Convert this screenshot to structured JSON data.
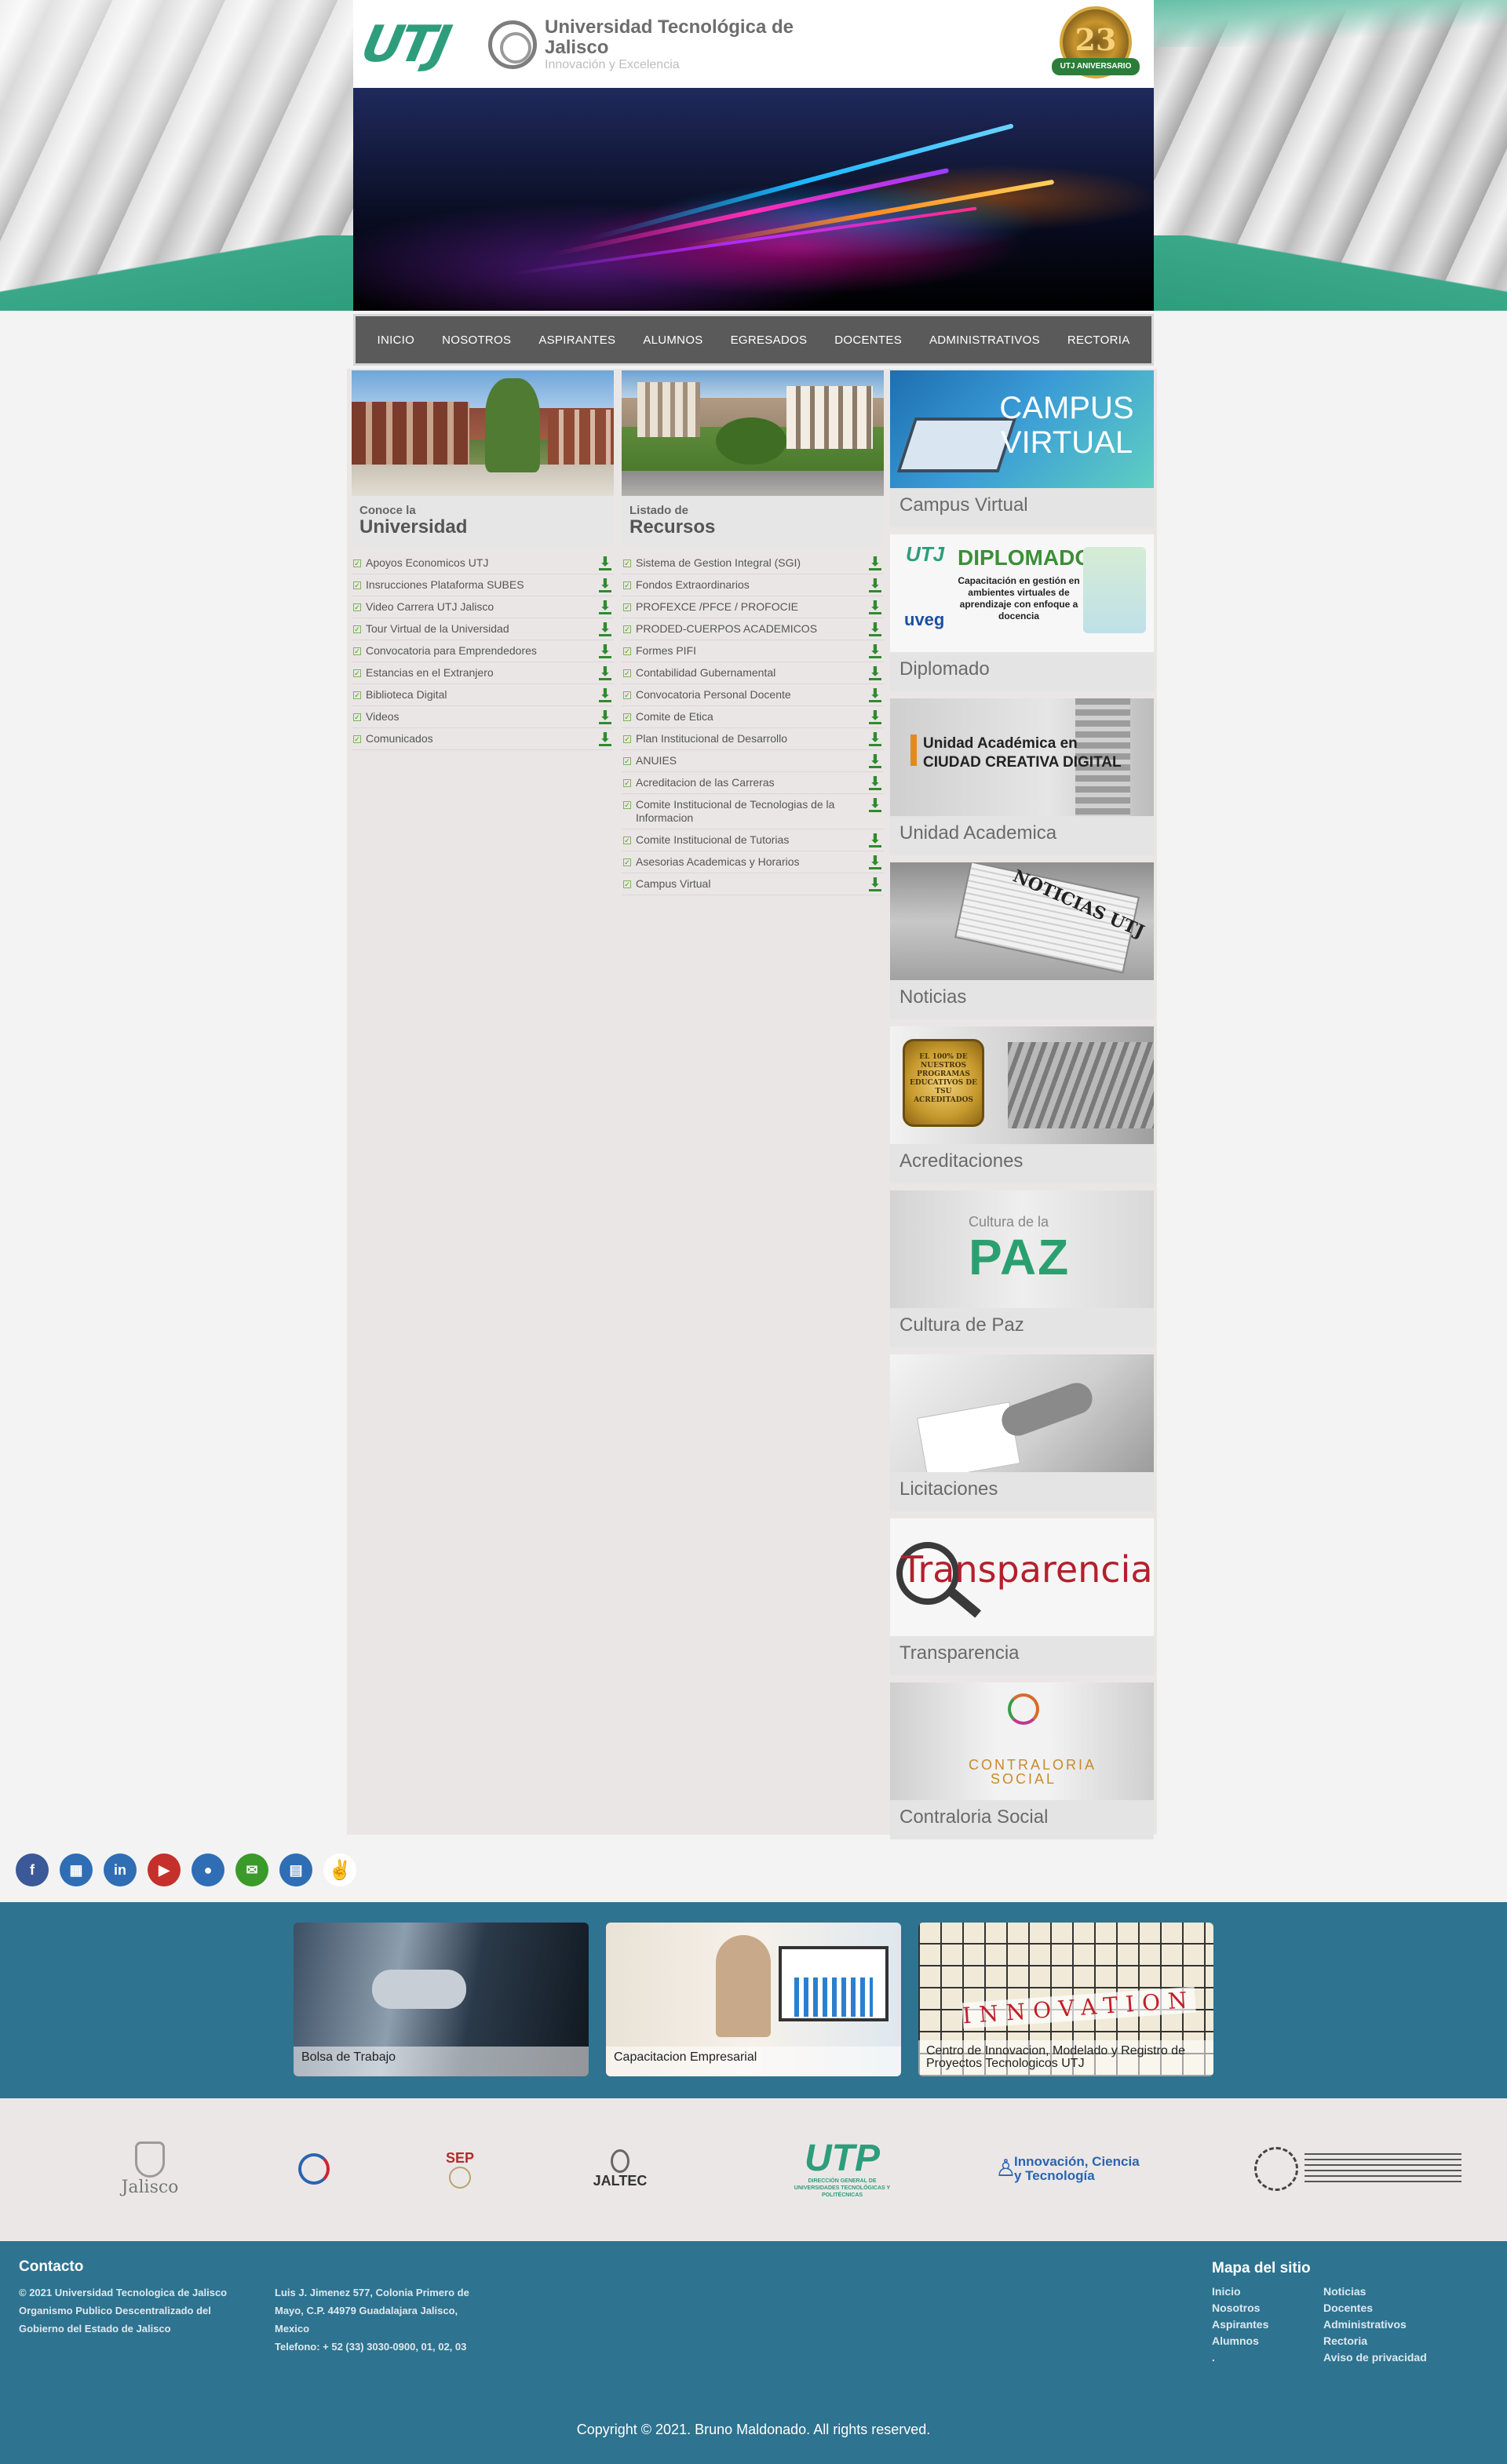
{
  "header": {
    "logo_text": "UTJ",
    "university_name": "Universidad Tecnológica de Jalisco",
    "slogan": "Innovación y Excelencia",
    "anniversary_number": "23",
    "anniversary_ribbon": "UTJ ANIVERSARIO"
  },
  "nav": {
    "items": [
      "INICIO",
      "NOSOTROS",
      "ASPIRANTES",
      "ALUMNOS",
      "EGRESADOS",
      "DOCENTES",
      "ADMINISTRATIVOS",
      "RECTORIA"
    ]
  },
  "universidad": {
    "heading_small": "Conoce la",
    "heading_big": "Universidad",
    "links": [
      "Apoyos Economicos UTJ",
      "Insrucciones Plataforma SUBES",
      "Video Carrera UTJ Jalisco",
      "Tour Virtual de la Universidad",
      "Convocatoria para Emprendedores",
      "Estancias en el Extranjero",
      "Biblioteca Digital",
      "Videos",
      "Comunicados"
    ]
  },
  "recursos": {
    "heading_small": "Listado de",
    "heading_big": "Recursos",
    "links": [
      "Sistema de Gestion Integral (SGI)",
      "Fondos Extraordinarios",
      "PROFEXCE /PFCE / PROFOCIE",
      "PRODED-CUERPOS ACADEMICOS",
      "Formes PIFI",
      "Contabilidad Gubernamental",
      "Convocatoria Personal Docente",
      "Comite de Etica",
      "Plan Institucional de Desarrollo",
      "ANUIES",
      "Acreditacion de las Carreras",
      "Comite Institucional de Tecnologias de la Informacion",
      "Comite Institucional de Tutorias",
      "Asesorias Academicas y Horarios",
      "Campus Virtual"
    ]
  },
  "tiles": [
    {
      "label": "Campus Virtual",
      "image_text": "CAMPUS VIRTUAL"
    },
    {
      "label": "Diplomado",
      "image_text": "DIPLOMADO",
      "image_sub": "Capacitación en gestión en ambientes virtuales de aprendizaje con enfoque a docencia"
    },
    {
      "label": "Unidad Academica",
      "image_text": "Unidad Académica en CIUDAD CREATIVA DIGITAL"
    },
    {
      "label": "Noticias",
      "image_text": "NOTICIAS UTJ"
    },
    {
      "label": "Acreditaciones",
      "image_text": "EL 100% DE NUESTROS PROGRAMAS EDUCATIVOS DE TSU ACREDITADOS"
    },
    {
      "label": "Cultura de Paz",
      "image_text": "PAZ",
      "image_sub": "Cultura de la"
    },
    {
      "label": "Licitaciones"
    },
    {
      "label": "Transparencia",
      "image_text": "Transparencia"
    },
    {
      "label": "Contraloria Social",
      "image_text": "CONTRALORIA SOCIAL"
    }
  ],
  "social": [
    {
      "icon": "facebook-icon",
      "glyph": "f",
      "color": "#3b5998"
    },
    {
      "icon": "map-icon",
      "glyph": "▦",
      "color": "#2f6db5"
    },
    {
      "icon": "linkedin-icon",
      "glyph": "in",
      "color": "#2f6db5"
    },
    {
      "icon": "youtube-icon",
      "glyph": "▶",
      "color": "#c4302b"
    },
    {
      "icon": "microphone-icon",
      "glyph": "●",
      "color": "#2f6db5"
    },
    {
      "icon": "email-icon",
      "glyph": "✉",
      "color": "#3a9a2a"
    },
    {
      "icon": "film-icon",
      "glyph": "▤",
      "color": "#2f6db5"
    },
    {
      "icon": "peace-hand-icon",
      "glyph": "✌",
      "color": "#ffffff"
    }
  ],
  "services": [
    {
      "caption": "Bolsa de Trabajo"
    },
    {
      "caption": "Capacitacion Empresarial"
    },
    {
      "caption": "Centro de Innovacion, Modelado y Registro de Proyectos Tecnologicos UTJ",
      "image_text": "INNOVATION"
    }
  ],
  "partners": [
    {
      "name": "Jalisco",
      "icon": "jalisco-crest-icon"
    },
    {
      "name": "",
      "icon": "sport-logo-icon"
    },
    {
      "name": "SEP",
      "icon": "sep-shield-icon"
    },
    {
      "name": "JALTEC",
      "icon": "jaltec-logo-icon"
    },
    {
      "name": "UTP",
      "icon": "utp-logo-icon",
      "sub": "DIRECCIÓN GENERAL DE UNIVERSIDADES TECNOLÓGICAS Y POLITÉCNICAS"
    },
    {
      "name": "Innovación, Ciencia y Tecnología",
      "icon": "person-figure-icon"
    },
    {
      "name": "",
      "icon": "iso-certification-icon"
    }
  ],
  "footer": {
    "contact_title": "Contacto",
    "contact_lines": [
      "© 2021 Universidad Tecnologica de Jalisco",
      "Organismo Publico Descentralizado del Gobierno del Estado de Jalisco"
    ],
    "address_lines": [
      "Luis J. Jimenez 577, Colonia Primero de Mayo, C.P. 44979 Guadalajara Jalisco, Mexico",
      "Telefono: + 52 (33) 3030-0900, 01, 02, 03"
    ],
    "sitemap_title": "Mapa del sitio",
    "sitemap_col1": [
      "Inicio",
      "Nosotros",
      "Aspirantes",
      "Alumnos",
      "."
    ],
    "sitemap_col2": [
      "Noticias",
      "Docentes",
      "Administrativos",
      "Rectoria",
      "Aviso de privacidad"
    ],
    "copyright": "Copyright © 2021. Bruno Maldonado. All rights reserved."
  }
}
